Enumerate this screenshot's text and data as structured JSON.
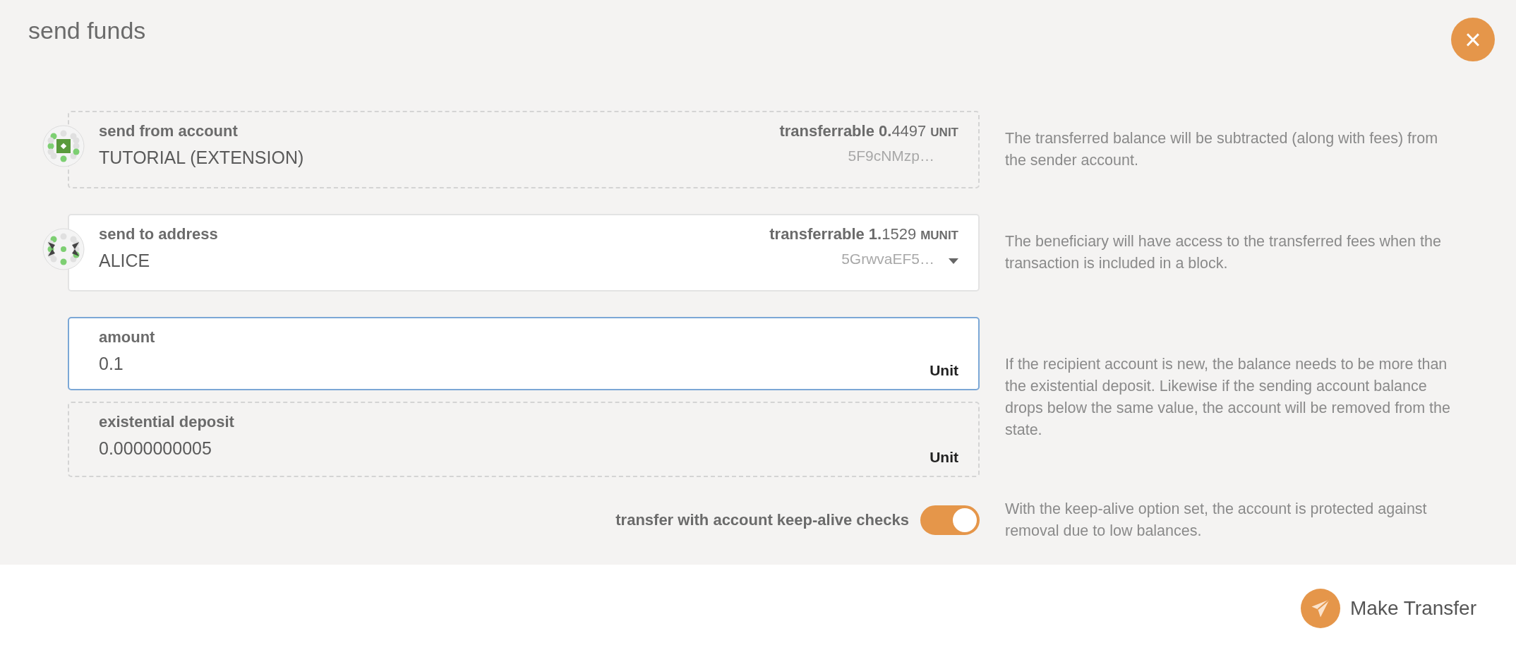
{
  "modal": {
    "title": "send funds",
    "close": "×"
  },
  "rows": [
    {
      "kind": "account",
      "editable": false,
      "label": "send from account",
      "name": "TUTORIAL (EXTENSION)",
      "balance": "**transferrable 0.**4497",
      "unit": "UNIT",
      "address": "5F9cNMzp…",
      "help": "The transferred balance will be subtracted (along with fees) from the sender account."
    },
    {
      "kind": "account",
      "editable": true,
      "label": "send to address",
      "name": "ALICE",
      "balance": "**transferrable 1.**1529",
      "unit": "MUNIT",
      "address": "5GrwvaEF5…",
      "help": "The beneficiary will have access to the transferred fees when the transaction is included in a block."
    },
    {
      "kind": "amounts",
      "help": "If the recipient account is new, the balance needs to be more than the existential deposit. Likewise if the sending account balance drops below the same value, the account will be removed from the state.",
      "fields": [
        {
          "label": "amount",
          "value": "0.1",
          "unit": "Unit",
          "editable": true,
          "focused": true
        },
        {
          "label": "existential deposit",
          "value": "0.0000000005",
          "unit": "Unit",
          "editable": false,
          "focused": false
        }
      ]
    },
    {
      "kind": "toggle",
      "label": "transfer with account keep-alive checks",
      "on": true,
      "help": "With the keep-alive option set, the account is protected against removal due to low balances."
    }
  ],
  "footer": {
    "button": "Make Transfer"
  }
}
